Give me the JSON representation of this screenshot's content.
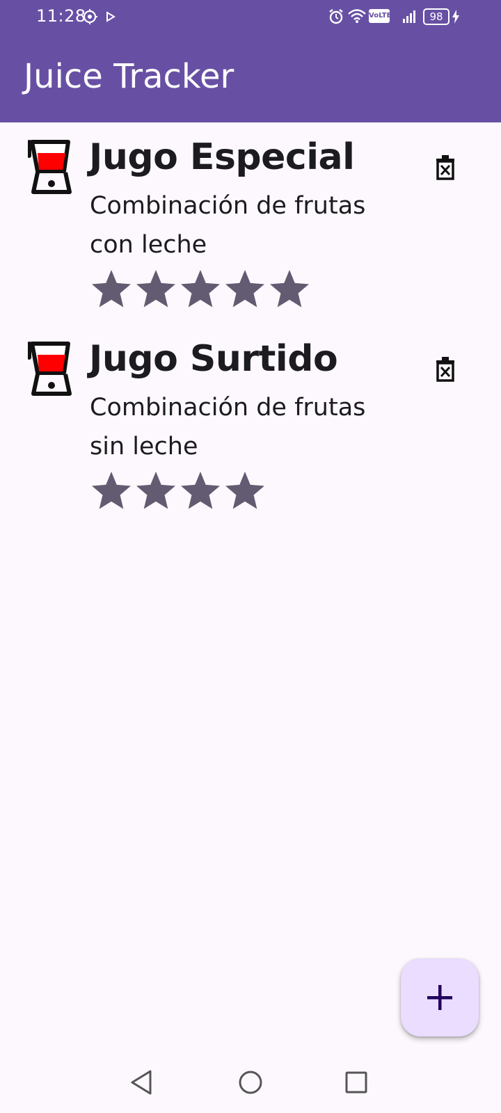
{
  "status_bar": {
    "time": "11:28",
    "volte": "VoLTE",
    "battery_level": "98"
  },
  "app_bar": {
    "title": "Juice Tracker"
  },
  "juices": [
    {
      "name": "Jugo Especial",
      "description": "Combinación de frutas con leche",
      "rating": 5
    },
    {
      "name": "Jugo Surtido",
      "description": "Combinación de frutas sin leche",
      "rating": 4
    }
  ],
  "icons": {
    "juice_item": "blender-icon",
    "delete": "delete-icon",
    "fab": "plus-icon",
    "nav_back": "triangle-back-icon",
    "nav_home": "circle-home-icon",
    "nav_recents": "square-recents-icon"
  },
  "colors": {
    "primary": "#6750a4",
    "background": "#fdf8fd",
    "fab_container": "#eaddff",
    "fab_icon": "#21005d",
    "star": "#625b71",
    "juice_red": "#ff0000"
  }
}
